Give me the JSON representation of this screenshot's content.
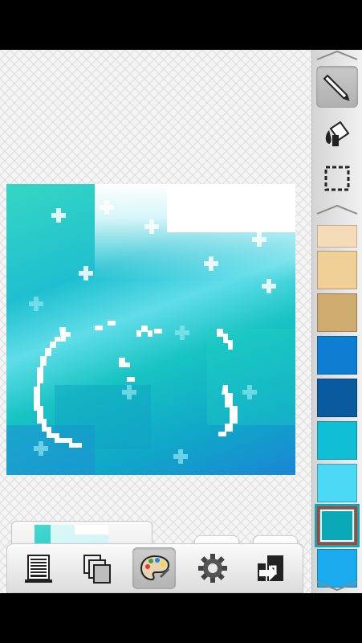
{
  "app": {
    "workspace_background": "#f4f4f4",
    "sidebar_tools": [
      {
        "icon": "pencil-icon",
        "active": true
      },
      {
        "icon": "paint-bucket-icon",
        "active": false
      },
      {
        "icon": "selection-marquee-icon",
        "active": false
      }
    ],
    "palette": {
      "partial_top": "#f5dcb8",
      "swatches": [
        "#f0cf97",
        "#cfab70",
        "#0e7ed2",
        "#0a5aa0",
        "#10bfd6",
        "#4bd9f6",
        "#0aa9b8",
        "#19abed"
      ],
      "selected_index": 6
    },
    "history": {
      "undo_icon": "undo-arrow-icon",
      "redo_icon": "redo-arrow-icon"
    },
    "bottom_toolbar": [
      {
        "icon": "layers-list-icon",
        "active": false
      },
      {
        "icon": "frames-copy-icon",
        "active": false
      },
      {
        "icon": "palette-icon",
        "active": true
      },
      {
        "icon": "gear-icon",
        "active": false
      },
      {
        "icon": "export-icon",
        "active": false
      }
    ]
  }
}
